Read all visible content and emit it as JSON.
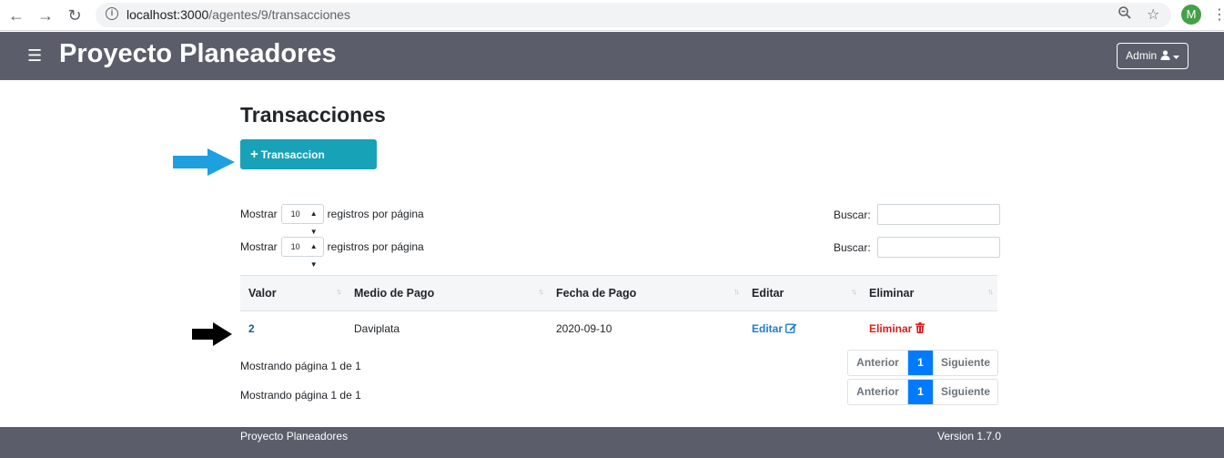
{
  "browser": {
    "url_host": "localhost:3000",
    "url_path": "/agentes/9/transacciones",
    "profile_initial": "M"
  },
  "header": {
    "brand": "Proyecto Planeadores",
    "admin_label": "Admin"
  },
  "page": {
    "title": "Transacciones",
    "add_button_label": "Transaccion"
  },
  "controls": [
    {
      "show_prefix": "Mostrar",
      "page_size": "10",
      "show_suffix": "registros por página",
      "search_label": "Buscar:"
    },
    {
      "show_prefix": "Mostrar",
      "page_size": "10",
      "show_suffix": "registros por página",
      "search_label": "Buscar:"
    }
  ],
  "table": {
    "headers": [
      "Valor",
      "Medio de Pago",
      "Fecha de Pago",
      "Editar",
      "Eliminar"
    ],
    "rows": [
      {
        "valor": "2",
        "medio": "Daviplata",
        "fecha": "2020-09-10",
        "editar": "Editar",
        "eliminar": "Eliminar"
      }
    ]
  },
  "pagination": [
    {
      "info": "Mostrando página 1 de 1",
      "prev": "Anterior",
      "current": "1",
      "next": "Siguiente"
    },
    {
      "info": "Mostrando página 1 de 1",
      "prev": "Anterior",
      "current": "1",
      "next": "Siguiente"
    }
  ],
  "footer": {
    "left": "Proyecto Planeadores",
    "right": "Version 1.7.0"
  },
  "colors": {
    "navbar": "#5b5d6a",
    "add_button": "#17a2b8",
    "pager_active": "#007bff",
    "delete": "#dc1e1e",
    "edit": "#1d7bd8"
  }
}
